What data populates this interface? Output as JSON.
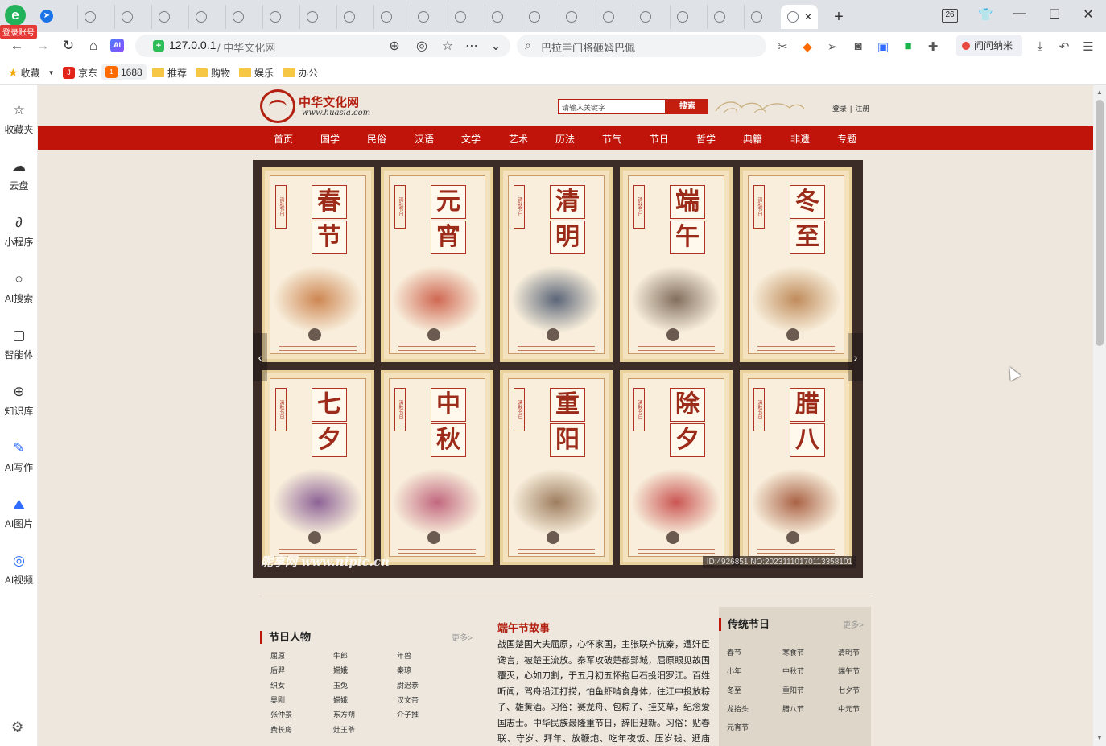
{
  "browser": {
    "logo_letter": "e",
    "login_badge": "登录账号",
    "tab_count": 20,
    "tab_counter": "26",
    "window": {
      "minimize": "—",
      "maximize": "☐",
      "close": "✕"
    }
  },
  "address": {
    "host": "127.0.0.1",
    "separator_title": "/ 中华文化网",
    "search_text": "巴拉圭门将砸姆巴佩",
    "ai_label": "AI",
    "ask_label": "问问纳米"
  },
  "bookmarks": {
    "favorites": "收藏",
    "jd": "京东",
    "b1688": "1688",
    "folders": [
      "推荐",
      "购物",
      "娱乐",
      "办公"
    ]
  },
  "sidebar": {
    "items": [
      {
        "label": "收藏夹",
        "icon": "star-icon"
      },
      {
        "label": "云盘",
        "icon": "cloud-icon"
      },
      {
        "label": "小程序",
        "icon": "mini-program-icon"
      },
      {
        "label": "AI搜索",
        "icon": "search-icon"
      },
      {
        "label": "智能体",
        "icon": "agent-icon"
      },
      {
        "label": "知识库",
        "icon": "knowledge-icon"
      },
      {
        "label": "AI写作",
        "icon": "pen-icon"
      },
      {
        "label": "AI图片",
        "icon": "image-icon"
      },
      {
        "label": "AI视频",
        "icon": "video-icon"
      }
    ]
  },
  "site": {
    "logo_name": "中华文化网",
    "logo_url": "www.huasia.com",
    "search_placeholder": "请输入关键字",
    "search_button": "搜索",
    "login": "登录",
    "register": "注册",
    "nav": [
      "首页",
      "国学",
      "民俗",
      "汉语",
      "文学",
      "艺术",
      "历法",
      "节气",
      "节日",
      "哲学",
      "典籍",
      "非遗",
      "专题"
    ]
  },
  "banner": {
    "posters": [
      {
        "title": [
          "春",
          "节"
        ],
        "ink": "#c6743a"
      },
      {
        "title": [
          "元",
          "宵"
        ],
        "ink": "#c8503a"
      },
      {
        "title": [
          "清",
          "明"
        ],
        "ink": "#3f4d66"
      },
      {
        "title": [
          "端",
          "午"
        ],
        "ink": "#6e5848"
      },
      {
        "title": [
          "冬",
          "至"
        ],
        "ink": "#b57a44"
      },
      {
        "title": [
          "七",
          "夕"
        ],
        "ink": "#7a4a8a"
      },
      {
        "title": [
          "中",
          "秋"
        ],
        "ink": "#b8506e"
      },
      {
        "title": [
          "重",
          "阳"
        ],
        "ink": "#8e6a4a"
      },
      {
        "title": [
          "除",
          "夕"
        ],
        "ink": "#c23b3b"
      },
      {
        "title": [
          "腊",
          "八"
        ],
        "ink": "#9c4a2c"
      }
    ],
    "tag_text": "清秋节日",
    "watermark_brand": "昵享网 www.nipic.cn",
    "watermark_id": "ID:4926851 NO:20231110170113358101"
  },
  "people": {
    "title": "节日人物",
    "more": "更多>",
    "names": [
      "屈原",
      "牛郎",
      "年兽",
      "后羿",
      "嫦娥",
      "秦琼",
      "织女",
      "玉兔",
      "尉迟恭",
      "吴刚",
      "嫦娥",
      "汉文帝",
      "张仲景",
      "东方朔",
      "介子推",
      "费长房",
      "灶王爷"
    ]
  },
  "story": {
    "title": "端午节故事",
    "body": "战国楚国大夫屈原，心怀家国，主张联齐抗秦，遭奸臣谗言，被楚王流放。秦军攻破楚都郢城，屈原眼见故国覆灭，心如刀割，于五月初五怀抱巨石投汨罗江。百姓听闻，驾舟沿江打捞，怕鱼虾啃食身体，往江中投放粽子、雄黄酒。习俗：赛龙舟、包粽子、挂艾草，纪念爱国志士。中华民族最隆重节日，辞旧迎新。习俗：贴春联、守岁、拜年、放鞭炮、吃年夜饭、压岁钱、逛庙会。"
  },
  "festivals": {
    "title": "传统节日",
    "more": "更多>",
    "items": [
      "春节",
      "寒食节",
      "清明节",
      "小年",
      "中秋节",
      "端午节",
      "冬至",
      "重阳节",
      "七夕节",
      "龙抬头",
      "腊八节",
      "中元节",
      "元宵节"
    ]
  }
}
